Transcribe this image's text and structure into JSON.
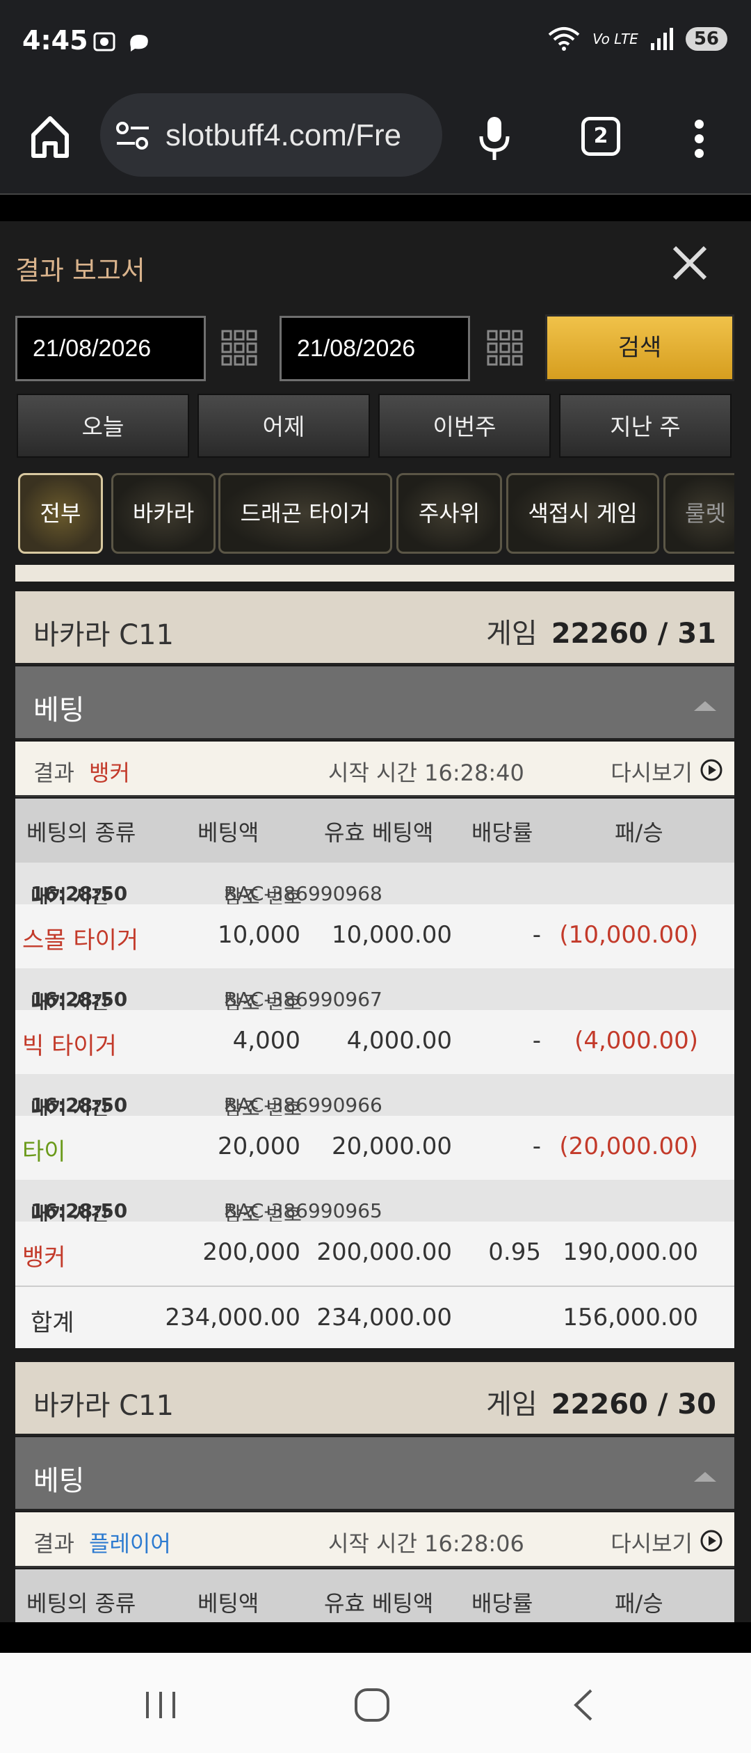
{
  "status": {
    "time": "4:45",
    "battery": "56",
    "network": "Vo LTE"
  },
  "browser": {
    "url": "slotbuff4.com/Fre",
    "tab_count": "2"
  },
  "report": {
    "title": "결과 보고서",
    "date_from": "21/08/2026",
    "date_to": "21/08/2026",
    "search_label": "검색",
    "ranges": [
      "오늘",
      "어제",
      "이번주",
      "지난 주"
    ],
    "categories": [
      "전부",
      "바카라",
      "드래곤 타이거",
      "주사위",
      "색접시 게임",
      "룰렛"
    ],
    "active_category": "전부"
  },
  "labels": {
    "betting": "베팅",
    "result": "결과",
    "start_time": "시작 시간",
    "replay": "다시보기",
    "game": "게임",
    "total": "합계",
    "exit_time": "내기 시간",
    "ref_no": "참조 번호",
    "col_type": "베팅의 종류",
    "col_amount": "베팅액",
    "col_valid": "유효 베팅액",
    "col_odds": "배당률",
    "col_winloss": "패/승"
  },
  "games": [
    {
      "table": "바카라 C11",
      "round": "22260 / 31",
      "result": "뱅커",
      "start_time": "16:28:40",
      "bets": [
        {
          "time": "16:28:50",
          "ref": "BAC-386990968",
          "type": "스몰 타이거",
          "amount": "10,000",
          "valid": "10,000.00",
          "odds": "-",
          "winloss": "(10,000.00)"
        },
        {
          "time": "16:28:50",
          "ref": "BAC-386990967",
          "type": "빅 타이거",
          "amount": "4,000",
          "valid": "4,000.00",
          "odds": "-",
          "winloss": "(4,000.00)"
        },
        {
          "time": "16:28:50",
          "ref": "BAC-386990966",
          "type": "타이",
          "amount": "20,000",
          "valid": "20,000.00",
          "odds": "-",
          "winloss": "(20,000.00)"
        },
        {
          "time": "16:28:50",
          "ref": "BAC-386990965",
          "type": "뱅커",
          "amount": "200,000",
          "valid": "200,000.00",
          "odds": "0.95",
          "winloss": "190,000.00"
        }
      ],
      "total_amount": "234,000.00",
      "total_valid": "234,000.00",
      "total_winloss": "156,000.00"
    },
    {
      "table": "바카라 C11",
      "round": "22260 / 30",
      "result": "플레이어",
      "start_time": "16:28:06"
    }
  ]
}
